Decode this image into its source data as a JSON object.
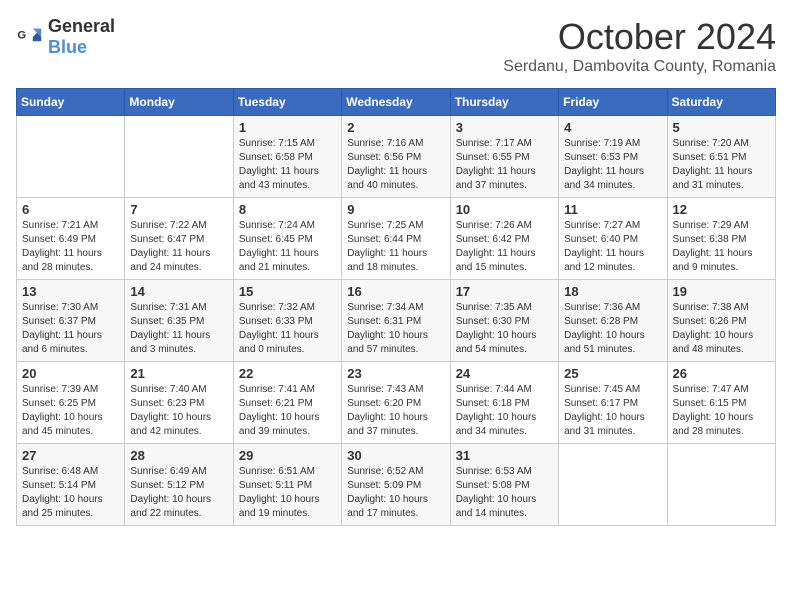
{
  "header": {
    "logo_general": "General",
    "logo_blue": "Blue",
    "month_title": "October 2024",
    "subtitle": "Serdanu, Dambovita County, Romania"
  },
  "weekdays": [
    "Sunday",
    "Monday",
    "Tuesday",
    "Wednesday",
    "Thursday",
    "Friday",
    "Saturday"
  ],
  "weeks": [
    [
      {
        "day": "",
        "info": ""
      },
      {
        "day": "",
        "info": ""
      },
      {
        "day": "1",
        "info": "Sunrise: 7:15 AM\nSunset: 6:58 PM\nDaylight: 11 hours and 43 minutes."
      },
      {
        "day": "2",
        "info": "Sunrise: 7:16 AM\nSunset: 6:56 PM\nDaylight: 11 hours and 40 minutes."
      },
      {
        "day": "3",
        "info": "Sunrise: 7:17 AM\nSunset: 6:55 PM\nDaylight: 11 hours and 37 minutes."
      },
      {
        "day": "4",
        "info": "Sunrise: 7:19 AM\nSunset: 6:53 PM\nDaylight: 11 hours and 34 minutes."
      },
      {
        "day": "5",
        "info": "Sunrise: 7:20 AM\nSunset: 6:51 PM\nDaylight: 11 hours and 31 minutes."
      }
    ],
    [
      {
        "day": "6",
        "info": "Sunrise: 7:21 AM\nSunset: 6:49 PM\nDaylight: 11 hours and 28 minutes."
      },
      {
        "day": "7",
        "info": "Sunrise: 7:22 AM\nSunset: 6:47 PM\nDaylight: 11 hours and 24 minutes."
      },
      {
        "day": "8",
        "info": "Sunrise: 7:24 AM\nSunset: 6:45 PM\nDaylight: 11 hours and 21 minutes."
      },
      {
        "day": "9",
        "info": "Sunrise: 7:25 AM\nSunset: 6:44 PM\nDaylight: 11 hours and 18 minutes."
      },
      {
        "day": "10",
        "info": "Sunrise: 7:26 AM\nSunset: 6:42 PM\nDaylight: 11 hours and 15 minutes."
      },
      {
        "day": "11",
        "info": "Sunrise: 7:27 AM\nSunset: 6:40 PM\nDaylight: 11 hours and 12 minutes."
      },
      {
        "day": "12",
        "info": "Sunrise: 7:29 AM\nSunset: 6:38 PM\nDaylight: 11 hours and 9 minutes."
      }
    ],
    [
      {
        "day": "13",
        "info": "Sunrise: 7:30 AM\nSunset: 6:37 PM\nDaylight: 11 hours and 6 minutes."
      },
      {
        "day": "14",
        "info": "Sunrise: 7:31 AM\nSunset: 6:35 PM\nDaylight: 11 hours and 3 minutes."
      },
      {
        "day": "15",
        "info": "Sunrise: 7:32 AM\nSunset: 6:33 PM\nDaylight: 11 hours and 0 minutes."
      },
      {
        "day": "16",
        "info": "Sunrise: 7:34 AM\nSunset: 6:31 PM\nDaylight: 10 hours and 57 minutes."
      },
      {
        "day": "17",
        "info": "Sunrise: 7:35 AM\nSunset: 6:30 PM\nDaylight: 10 hours and 54 minutes."
      },
      {
        "day": "18",
        "info": "Sunrise: 7:36 AM\nSunset: 6:28 PM\nDaylight: 10 hours and 51 minutes."
      },
      {
        "day": "19",
        "info": "Sunrise: 7:38 AM\nSunset: 6:26 PM\nDaylight: 10 hours and 48 minutes."
      }
    ],
    [
      {
        "day": "20",
        "info": "Sunrise: 7:39 AM\nSunset: 6:25 PM\nDaylight: 10 hours and 45 minutes."
      },
      {
        "day": "21",
        "info": "Sunrise: 7:40 AM\nSunset: 6:23 PM\nDaylight: 10 hours and 42 minutes."
      },
      {
        "day": "22",
        "info": "Sunrise: 7:41 AM\nSunset: 6:21 PM\nDaylight: 10 hours and 39 minutes."
      },
      {
        "day": "23",
        "info": "Sunrise: 7:43 AM\nSunset: 6:20 PM\nDaylight: 10 hours and 37 minutes."
      },
      {
        "day": "24",
        "info": "Sunrise: 7:44 AM\nSunset: 6:18 PM\nDaylight: 10 hours and 34 minutes."
      },
      {
        "day": "25",
        "info": "Sunrise: 7:45 AM\nSunset: 6:17 PM\nDaylight: 10 hours and 31 minutes."
      },
      {
        "day": "26",
        "info": "Sunrise: 7:47 AM\nSunset: 6:15 PM\nDaylight: 10 hours and 28 minutes."
      }
    ],
    [
      {
        "day": "27",
        "info": "Sunrise: 6:48 AM\nSunset: 5:14 PM\nDaylight: 10 hours and 25 minutes."
      },
      {
        "day": "28",
        "info": "Sunrise: 6:49 AM\nSunset: 5:12 PM\nDaylight: 10 hours and 22 minutes."
      },
      {
        "day": "29",
        "info": "Sunrise: 6:51 AM\nSunset: 5:11 PM\nDaylight: 10 hours and 19 minutes."
      },
      {
        "day": "30",
        "info": "Sunrise: 6:52 AM\nSunset: 5:09 PM\nDaylight: 10 hours and 17 minutes."
      },
      {
        "day": "31",
        "info": "Sunrise: 6:53 AM\nSunset: 5:08 PM\nDaylight: 10 hours and 14 minutes."
      },
      {
        "day": "",
        "info": ""
      },
      {
        "day": "",
        "info": ""
      }
    ]
  ]
}
